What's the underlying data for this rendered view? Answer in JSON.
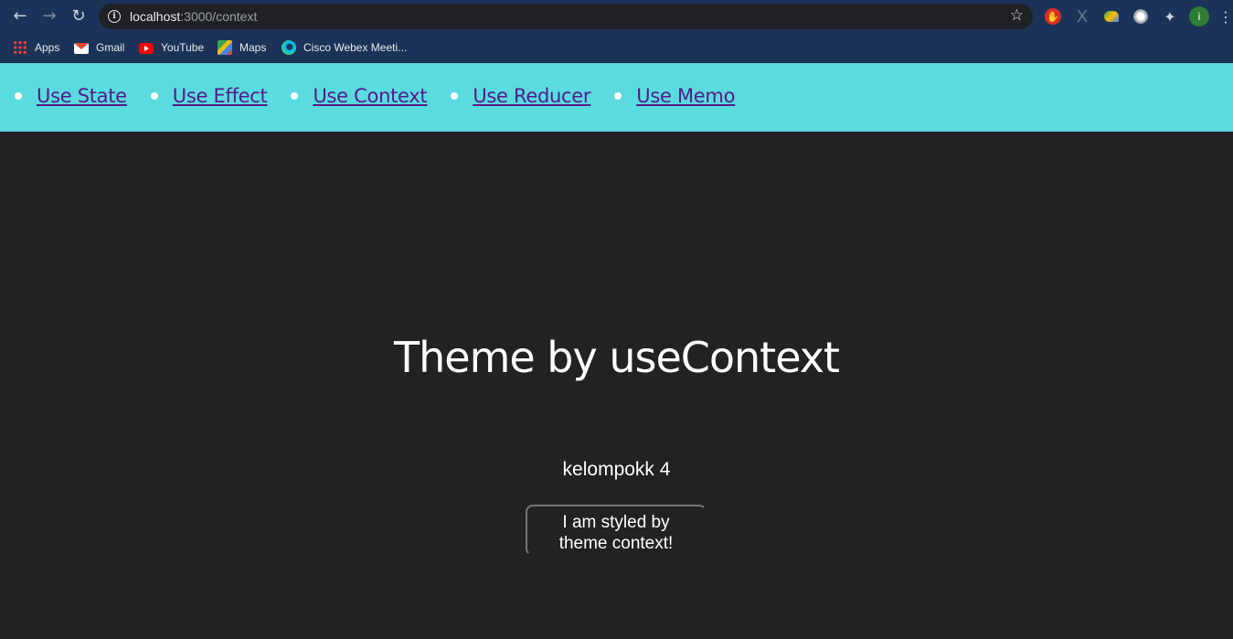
{
  "browser": {
    "address_bar": {
      "url_host": "localhost",
      "url_path": ":3000/context"
    },
    "nav_icons": {
      "back": "←",
      "forward": "→",
      "reload": "↻",
      "star": "☆",
      "puzzle": "✦",
      "menu": "⋮"
    },
    "profile_initial": "i",
    "bookmarks": [
      {
        "label": "Apps",
        "icon": "apps-icon"
      },
      {
        "label": "Gmail",
        "icon": "gmail-icon"
      },
      {
        "label": "YouTube",
        "icon": "youtube-icon"
      },
      {
        "label": "Maps",
        "icon": "maps-icon"
      },
      {
        "label": "Cisco Webex Meeti...",
        "icon": "webex-icon"
      }
    ]
  },
  "nav": {
    "items": [
      {
        "label": "Use State"
      },
      {
        "label": "Use Effect"
      },
      {
        "label": "Use Context"
      },
      {
        "label": "Use Reducer"
      },
      {
        "label": "Use Memo"
      }
    ]
  },
  "main": {
    "title": "Theme by useContext",
    "group_name": "kelompokk 4",
    "theme_button_label": "I am styled by theme context!"
  },
  "colors": {
    "nav_background": "#5adbdf",
    "page_background": "#222222",
    "link_color": "#551a8b",
    "browser_chrome": "#1b3358"
  }
}
